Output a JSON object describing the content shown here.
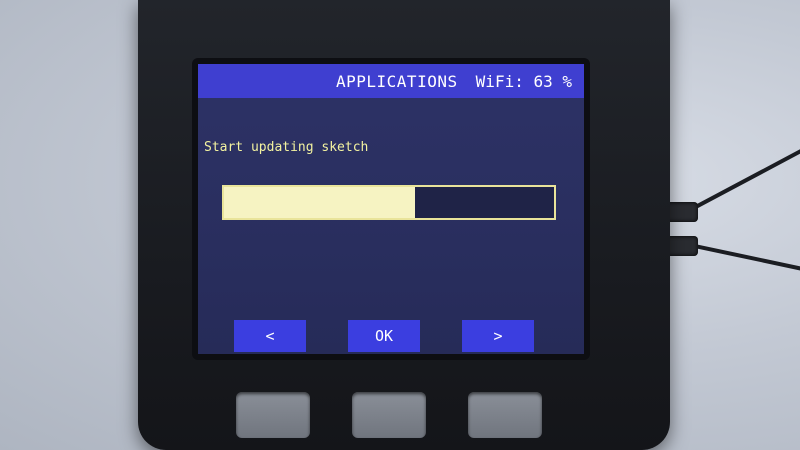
{
  "screen": {
    "title": "APPLICATIONS",
    "wifi_status": "WiFi: 63 %",
    "message": "Start updating sketch",
    "progress": 0.58,
    "softkeys": {
      "left": "<",
      "ok": "OK",
      "right": ">"
    }
  },
  "colors": {
    "topbar": "#3f3fd0",
    "screen_bg": "#2a2f60",
    "message_text": "#f3f2a0",
    "progress_fill": "#f6f3c2",
    "softkey_bg": "#3b3ee0"
  }
}
